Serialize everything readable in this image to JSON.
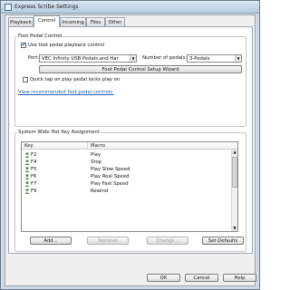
{
  "window": {
    "title": "Express Scribe Settings"
  },
  "tabs": [
    {
      "label": "Playback",
      "active": false
    },
    {
      "label": "Control",
      "active": true
    },
    {
      "label": "Incoming",
      "active": false
    },
    {
      "label": "Files",
      "active": false
    },
    {
      "label": "Other",
      "active": false
    }
  ],
  "foot_pedal": {
    "group_label": "Foot Pedal Control",
    "use_checkbox_label": "Use foot pedal playback control",
    "use_checked": true,
    "port_label": "Port:",
    "port_value": "VEC Infinity USB Pedals and Har",
    "pedals_label": "Number of pedals:",
    "pedals_value": "3-Pedals",
    "wizard_button": "Foot Pedal Control Setup Wizard",
    "quick_tap_label": "Quick tap on play pedal locks play on",
    "quick_tap_checked": false,
    "recommended_link": "View recommended foot pedal controls."
  },
  "hotkeys": {
    "group_label": "System Wide Hot Key Assignment",
    "col_key": "Key",
    "col_macro": "Macro",
    "rows": [
      {
        "key": "F2",
        "macro": "Play"
      },
      {
        "key": "F4",
        "macro": "Stop"
      },
      {
        "key": "F5",
        "macro": "Play Slow Speed"
      },
      {
        "key": "F6",
        "macro": "Play Real Speed"
      },
      {
        "key": "F7",
        "macro": "Play Fast Speed"
      },
      {
        "key": "F9",
        "macro": "Rewind"
      }
    ],
    "add_button": "Add...",
    "remove_button": "Remove",
    "change_button": "Change...",
    "defaults_button": "Set Defaults"
  },
  "footer": {
    "ok_button": "OK",
    "cancel_button": "Cancel",
    "help_button": "Help"
  },
  "colors": {
    "accent": "#1a5fb4",
    "icon_green": "#3a8f2a"
  }
}
